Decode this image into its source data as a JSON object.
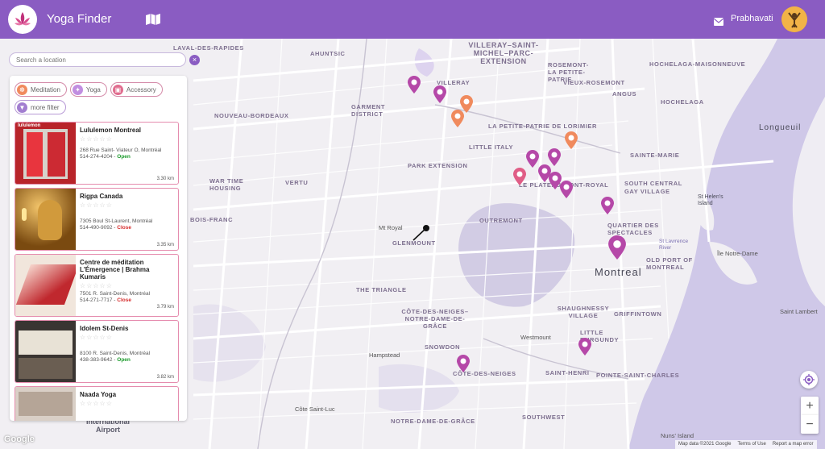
{
  "header": {
    "app_title": "Yoga Finder",
    "user_name": "Prabhavati",
    "brand_color": "#8a5cc2"
  },
  "search": {
    "placeholder": "Search a location",
    "clear_label": "×"
  },
  "filters": [
    {
      "label": "Meditation",
      "icon": "meditation-icon",
      "color": "#f08a5d"
    },
    {
      "label": "Yoga",
      "icon": "yoga-icon",
      "color": "#c18ee0"
    },
    {
      "label": "Accessory",
      "icon": "accessory-icon",
      "color": "#e06c8e"
    },
    {
      "label": "more filter",
      "icon": "filter-icon",
      "color": "#a27ed0"
    }
  ],
  "places": [
    {
      "name": "Lululemon Montreal",
      "stars": "☆☆☆☆☆",
      "address": "268 Rue Saint- Viateur O, Montréal",
      "phone": "514-274-4204",
      "status": "Open",
      "distance": "3.30 km"
    },
    {
      "name": "Rigpa Canada",
      "stars": "☆☆☆☆☆",
      "address": "7305 Boul St-Laurent, Montréal",
      "phone": "514-490-9092",
      "status": "Close",
      "distance": "3.35 km"
    },
    {
      "name": "Centre de méditation L'Émergence | Brahma Kumaris",
      "stars": "☆☆☆☆☆",
      "address": "7501 R. Saint-Denis, Montréal",
      "phone": "514-271-7717",
      "status": "Close",
      "distance": "3.79 km"
    },
    {
      "name": "Idolem St-Denis",
      "stars": "☆☆☆☆☆",
      "address": "8100 R. Saint-Denis, Montréal",
      "phone": "438-383-9642",
      "status": "Open",
      "distance": "3.82 km"
    },
    {
      "name": "Naada Yoga",
      "stars": "☆☆☆☆☆",
      "address": "",
      "phone": "",
      "status": "",
      "distance": ""
    }
  ],
  "thumb_text": {
    "lululemon_sign": "lululemon"
  },
  "map_labels": {
    "laval": "LAVAL-DES-RAPIDES",
    "ahuntsic": "AHUNTSIC",
    "villeray": "VILLERAY–SAINT-MICHEL–PARC-EXTENSION",
    "rosemont": "ROSEMONT-LA PETITE-PATRIE",
    "hochelaga": "HOCHELAGA-MAISONNEUVE",
    "villeray2": "VILLERAY",
    "vieux_rosemont": "VIEUX-ROSEMONT",
    "angus": "ANGUS",
    "garment": "GARMENT DISTRICT",
    "hochelaga2": "HOCHELAGA",
    "nouveau_bordeaux": "NOUVEAU-BORDEAUX",
    "petite_patrie": "LA PETITE-PATRIE DE LORIMIER",
    "longueuil": "Longueuil",
    "little_italy": "LITTLE ITALY",
    "sainte_marie": "SAINTE-MARIE",
    "park_extension": "PARK EXTENSION",
    "vertu": "VERTU",
    "war_time": "WAR TIME HOUSING",
    "plateau": "LE PLATEAU-MONT-ROYAL",
    "south_central": "SOUTH CENTRAL GAY VILLAGE",
    "st_helens": "St Helen's Island",
    "bois_franc": "BOIS-FRANC",
    "mt_royal": "Mt Royal",
    "outremont": "OUTREMONT",
    "quartier": "QUARTIER DES SPECTACLES",
    "glenmount": "GLENMOUNT",
    "st_lawrence": "St Lawrence River",
    "ile_notre_dame": "Île Notre-Dame",
    "old_port": "OLD PORT OF MONTREAL",
    "montreal": "Montreal",
    "the_triangle": "THE TRIANGLE",
    "shaughnessy": "SHAUGHNESSY VILLAGE",
    "griffintown": "GRIFFINTOWN",
    "saint_lambert": "Saint Lambert",
    "cote_des_neiges": "CÔTE-DES-NEIGES–NOTRE-DAME-DE-GRÂCE",
    "westmount": "Westmount",
    "little_burgundy": "LITTLE BURGUNDY",
    "snowdon": "SNOWDON",
    "hampstead": "Hampstead",
    "cote_des_neiges2": "CÔTE-DES-NEIGES",
    "saint_henri": "SAINT-HENRI",
    "pointe_saint_charles": "POINTE-SAINT-CHARLES",
    "cote_saint_luc": "Côte Saint-Luc",
    "ndg": "NOTRE-DAME-DE-GRÂCE",
    "southwest": "SOUTHWEST",
    "nuns_island": "Nuns' Island",
    "airport": "International Airport"
  },
  "map_controls": {
    "zoom_in": "+",
    "zoom_out": "−",
    "google": "Google"
  },
  "attribution": {
    "map_data": "Map data ©2021 Google",
    "terms": "Terms of Use",
    "report": "Report a map error"
  },
  "colors": {
    "pin_purple": "#b548a8",
    "pin_pink": "#e05d86",
    "pin_orange": "#f08a5d",
    "card_border": "#e58cae"
  }
}
